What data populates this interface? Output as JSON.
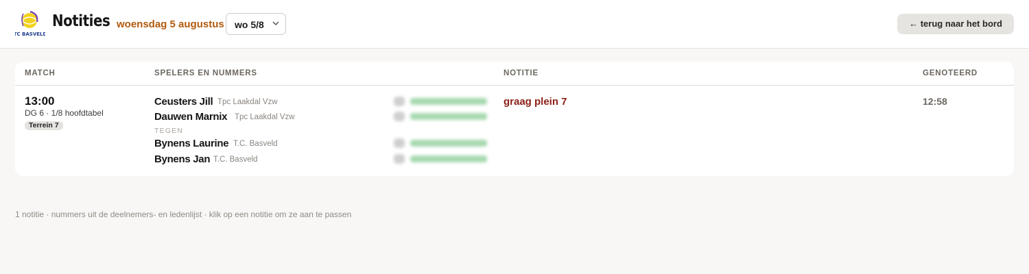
{
  "header": {
    "logo_text": "TC BASVELD",
    "title": "Notities",
    "date": "woensdag 5 augustus",
    "day_select": {
      "value": "wo 5/8"
    },
    "back_label": "← terug naar het bord"
  },
  "table": {
    "columns": [
      "MATCH",
      "SPELERS EN NUMMERS",
      "NOTITIE",
      "GENOTEERD"
    ],
    "rows": [
      {
        "time": "13:00",
        "desc": "DG 6 · 1/8 hoofdtabel",
        "court": "Terrein 7",
        "team1": [
          {
            "name": "Ceusters Jill",
            "club": "Tpc Laakdal Vzw"
          },
          {
            "name": "Dauwen Marnix",
            "club": "Tpc Laakdal Vzw"
          }
        ],
        "versus": "TEGEN",
        "team2": [
          {
            "name": "Bynens Laurine",
            "club": "T.C. Basveld"
          },
          {
            "name": "Bynens Jan",
            "club": "T.C. Basveld"
          }
        ],
        "note": "graag plein 7",
        "noted_at": "12:58"
      }
    ]
  },
  "footer": "1 notitie · nummers uit de deelnemers- en ledenlijst · klik op een notitie om ze aan te passen",
  "colors": {
    "accent_date": "#b25a0e",
    "note_text": "#8a1f16",
    "phone_blur": "#a7d9b0",
    "background": "#f8f7f5"
  },
  "icons": [
    "club-logo",
    "chevron-down-icon",
    "phone-icon"
  ]
}
